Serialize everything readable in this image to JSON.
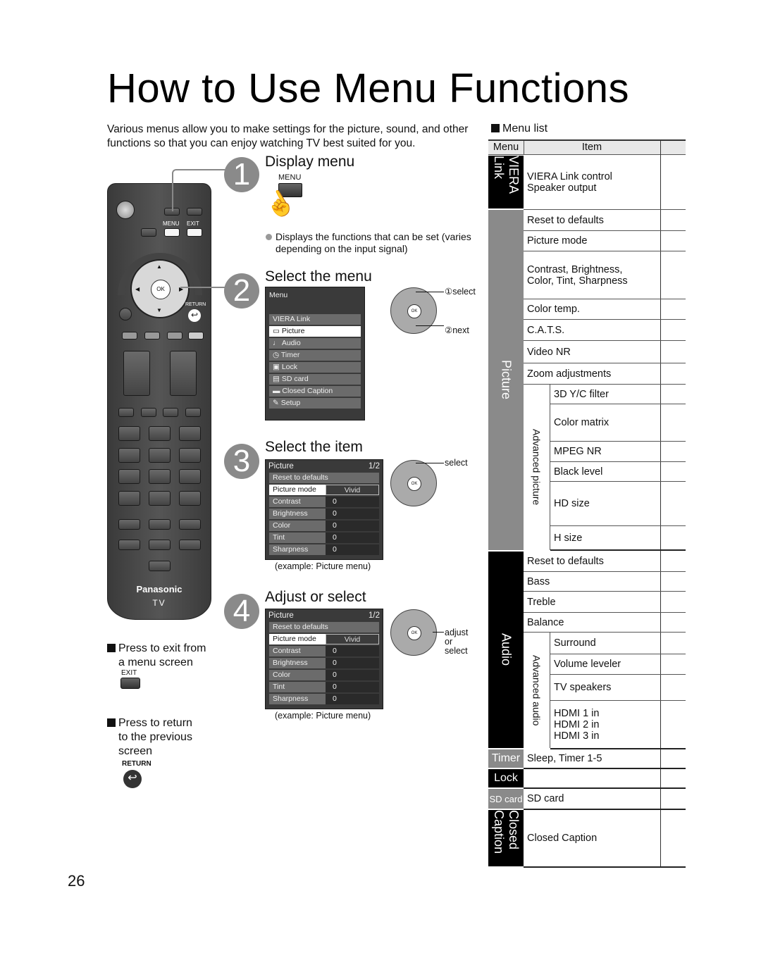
{
  "page": {
    "title": "How to Use Menu Functions",
    "intro": "Various menus allow you to make settings for the picture, sound, and other functions so that you can enjoy watching TV best suited for you.",
    "page_number": "26"
  },
  "remote": {
    "menu_label": "MENU",
    "exit_label": "EXIT",
    "ok_label": "OK",
    "return_label": "RETURN",
    "brand": "Panasonic",
    "tv_label": "TV"
  },
  "steps": [
    {
      "number": "1",
      "title": "Display menu",
      "button_label": "MENU",
      "note": "Displays the functions that can be set (varies depending on the input signal)"
    },
    {
      "number": "2",
      "title": "Select the menu",
      "osd_title": "Menu",
      "osd_items": [
        "VIERA Link",
        "Picture",
        "Audio",
        "Timer",
        "Lock",
        "SD card",
        "Closed Caption",
        "Setup"
      ],
      "selected_item": "Picture",
      "callout_select": "①select",
      "callout_next": "②next"
    },
    {
      "number": "3",
      "title": "Select the item",
      "callout": "select",
      "caption": "(example:  Picture menu)"
    },
    {
      "number": "4",
      "title": "Adjust or select",
      "callout": "adjust\nor\nselect",
      "callout_lines": [
        "adjust",
        "or",
        "select"
      ],
      "caption": "(example:  Picture menu)"
    }
  ],
  "picture_osd": {
    "title": "Picture",
    "page": "1/2",
    "rows": [
      {
        "label": "Reset to defaults",
        "value": ""
      },
      {
        "label": "Picture mode",
        "value": "Vivid"
      },
      {
        "label": "Contrast",
        "value": "0"
      },
      {
        "label": "Brightness",
        "value": "0"
      },
      {
        "label": "Color",
        "value": "0"
      },
      {
        "label": "Tint",
        "value": "0"
      },
      {
        "label": "Sharpness",
        "value": "0"
      }
    ]
  },
  "notes": {
    "exit": "Press to exit from a menu screen",
    "exit_line1": "Press to exit from",
    "exit_line2": "a menu screen",
    "exit_button": "EXIT",
    "return_line1": "Press to return",
    "return_line2": "to the previous",
    "return_line3": "screen",
    "return_button": "RETURN"
  },
  "menu_list": {
    "heading": "Menu list",
    "col_menu": "Menu",
    "col_item": "Item",
    "groups": {
      "viera": "VIERA Link",
      "picture": "Picture",
      "adv_picture": "Advanced picture",
      "audio": "Audio",
      "adv_audio": "Advanced audio",
      "timer": "Timer",
      "lock": "Lock",
      "sdcard": "SD card",
      "cc": "Closed Caption"
    },
    "items": {
      "viera_1": "VIERA Link control",
      "viera_2": "Speaker output",
      "p_reset": "Reset to defaults",
      "p_mode": "Picture mode",
      "p_cbc1": "Contrast, Brightness,",
      "p_cbc2": "Color, Tint, Sharpness",
      "p_temp": "Color temp.",
      "p_cats": "C.A.T.S.",
      "p_vnr": "Video NR",
      "p_zoom": "Zoom adjustments",
      "ap_3d": "3D Y/C filter",
      "ap_matrix": "Color matrix",
      "ap_mpeg": "MPEG NR",
      "ap_black": "Black level",
      "ap_hd": "HD size",
      "ap_h": "H size",
      "a_reset": "Reset to defaults",
      "a_bass": "Bass",
      "a_treble": "Treble",
      "a_balance": "Balance",
      "aa_surround": "Surround",
      "aa_vol": "Volume leveler",
      "aa_spk": "TV speakers",
      "aa_hdmi1": "HDMI 1 in",
      "aa_hdmi2": "HDMI 2 in",
      "aa_hdmi3": "HDMI 3 in",
      "timer": "Sleep, Timer 1-5",
      "lock": "",
      "sdcard": "SD card",
      "cc": "Closed Caption"
    }
  }
}
